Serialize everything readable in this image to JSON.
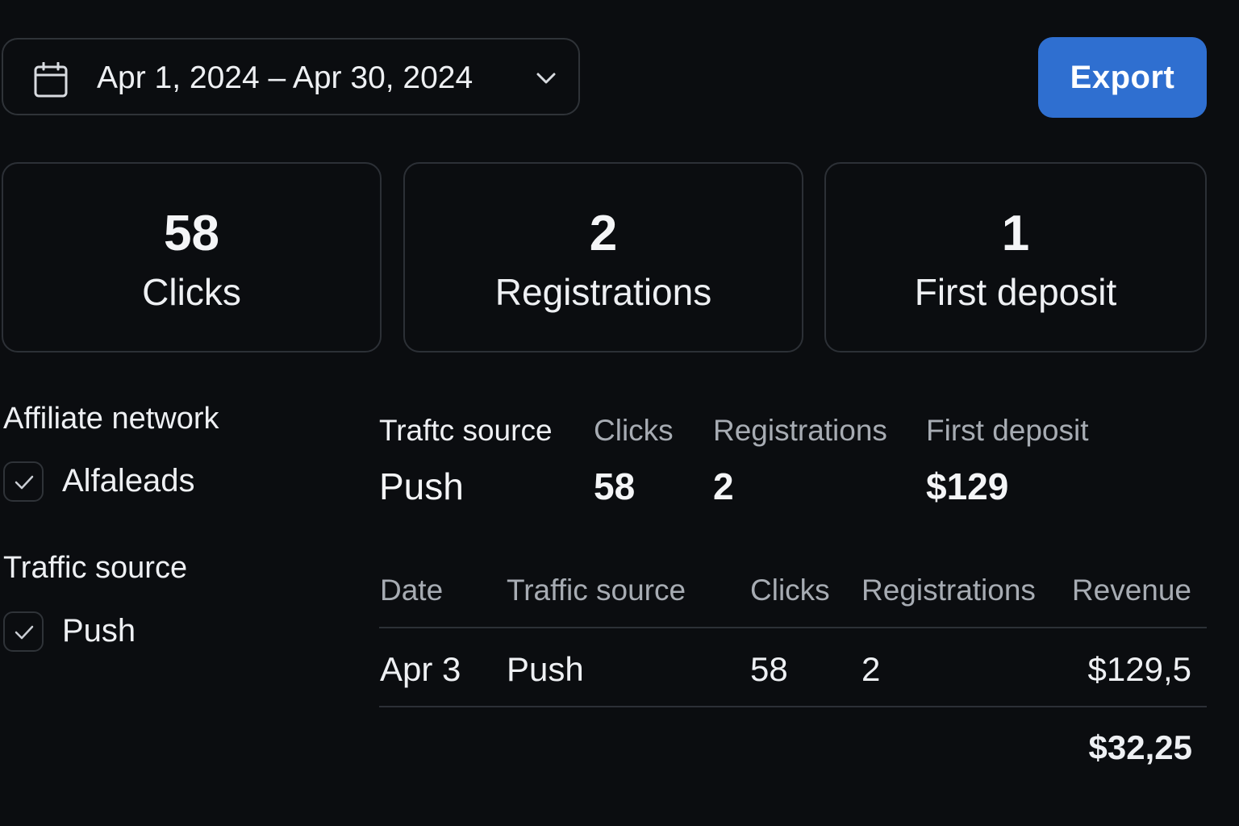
{
  "date_range": {
    "label": "Apr 1, 2024 – Apr 30, 2024",
    "icon": "calendar-icon",
    "dropdown_icon": "chevron-down-icon"
  },
  "export_button": {
    "label": "Export",
    "color": "#2f6fd0"
  },
  "kpis": [
    {
      "value": "58",
      "label": "Clicks"
    },
    {
      "value": "2",
      "label": "Registrations"
    },
    {
      "value": "1",
      "label": "First deposit"
    }
  ],
  "filters": {
    "affiliate_network": {
      "title": "Affiliate network",
      "options": [
        {
          "label": "Alfaleads",
          "checked": true
        }
      ]
    },
    "traffic_source": {
      "title": "Traffic source",
      "options": [
        {
          "label": "Push",
          "checked": true
        }
      ]
    }
  },
  "summary_table": {
    "headers": [
      "Traftc source",
      "Clicks",
      "Registrations",
      "First deposit"
    ],
    "row": [
      "Push",
      "58",
      "2",
      "$129"
    ]
  },
  "detail_table": {
    "headers": [
      "Date",
      "Traffic source",
      "Clicks",
      "Registrations",
      "Revenue"
    ],
    "rows": [
      [
        "Apr 3",
        "Push",
        "58",
        "2",
        "$129,5"
      ]
    ],
    "total_revenue": "$32,25"
  }
}
